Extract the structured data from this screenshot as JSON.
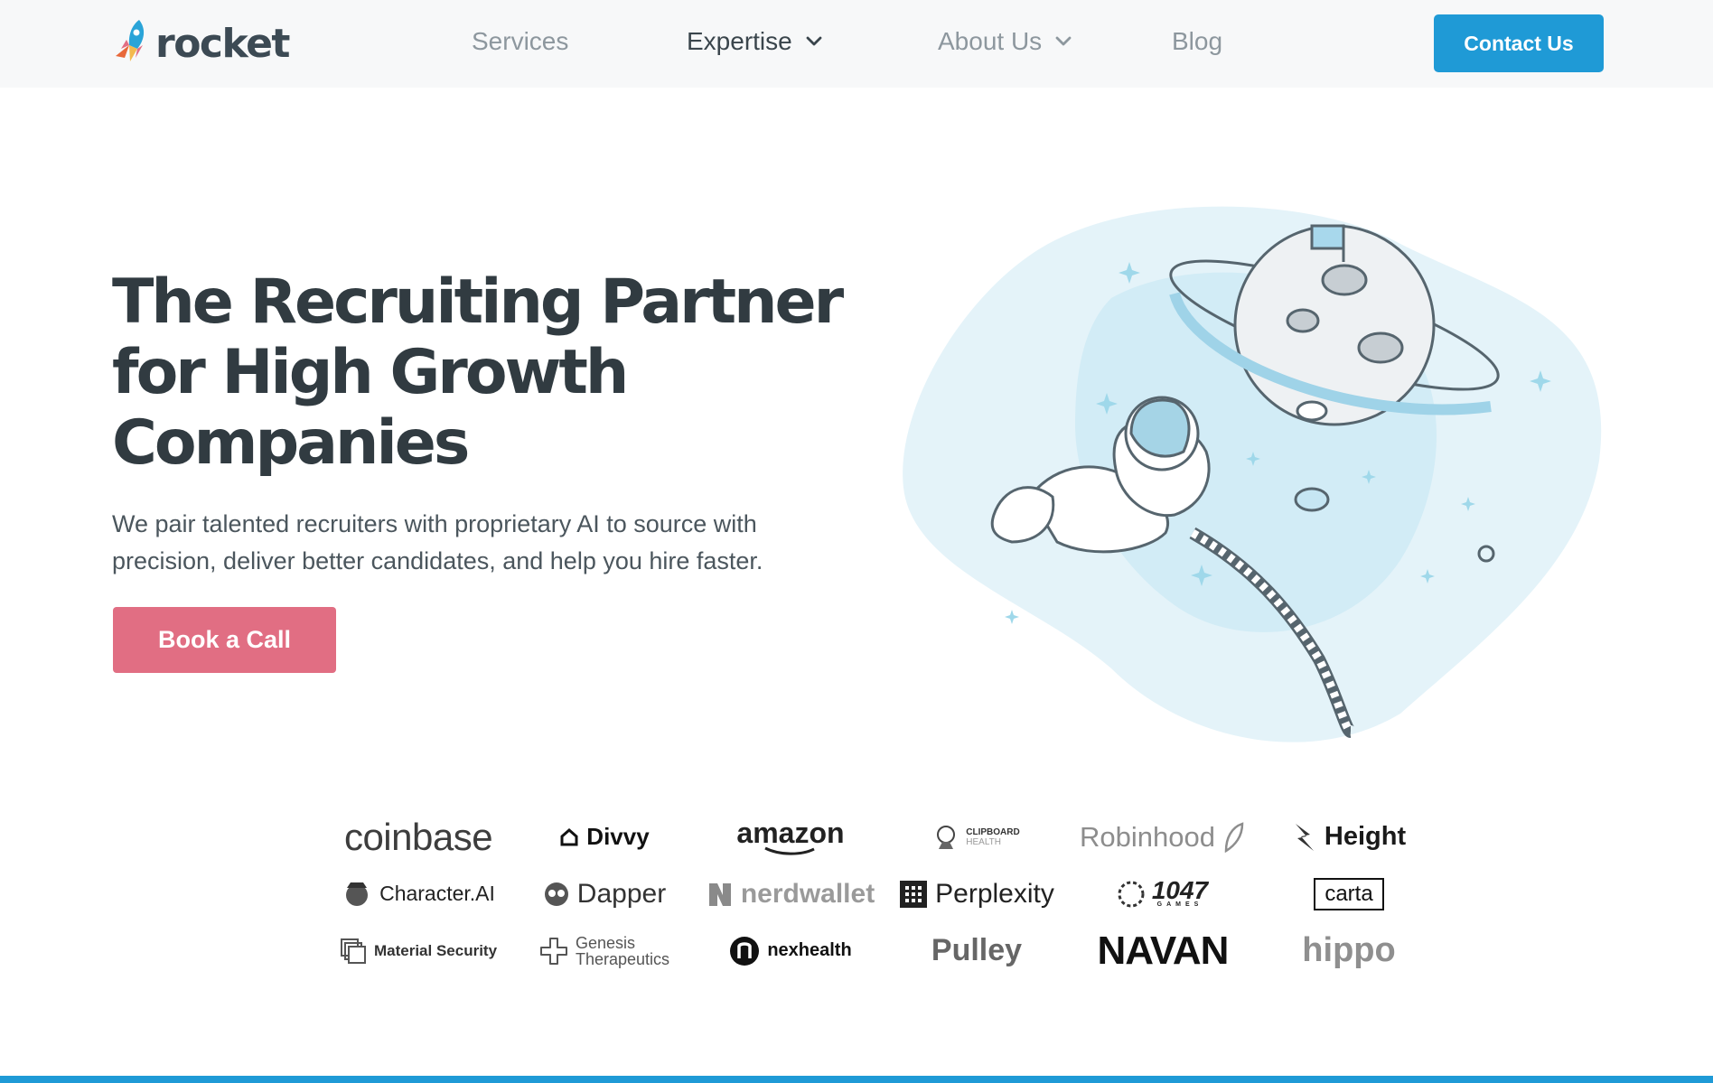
{
  "nav": {
    "logo_text": "rocket",
    "items": [
      {
        "label": "Services"
      },
      {
        "label": "Expertise"
      },
      {
        "label": "About Us"
      },
      {
        "label": "Blog"
      }
    ],
    "contact_label": "Contact Us"
  },
  "hero": {
    "title_lines": [
      "The Recruiting Partner",
      "for High Growth",
      "Companies"
    ],
    "subtitle": "We pair talented recruiters with proprietary AI to source with precision, deliver better candidates, and help you hire faster.",
    "cta_label": "Book a Call"
  },
  "clients": [
    "coinbase",
    "Divvy",
    "amazon",
    "CLIPBOARD",
    "Robinhood",
    "Height",
    "Character.AI",
    "Dapper",
    "nerdwallet",
    "Perplexity",
    "1047",
    "carta",
    "Material Security",
    "Genesis Therapeutics",
    "nexhealth",
    "Pulley",
    "NAVAN",
    "hippo"
  ],
  "client_sub": {
    "clipboard": "HEALTH",
    "1047": "GAMES",
    "genesis_line1": "Genesis",
    "genesis_line2": "Therapeutics"
  },
  "colors": {
    "brand_blue": "#1f9ad6",
    "cta_pink": "#e16e83",
    "nav_bg": "#f7f8f9",
    "heading": "#313b41"
  },
  "icons": [
    "rocket-logo-icon",
    "chevron-down-icon",
    "astronaut-illustration"
  ]
}
